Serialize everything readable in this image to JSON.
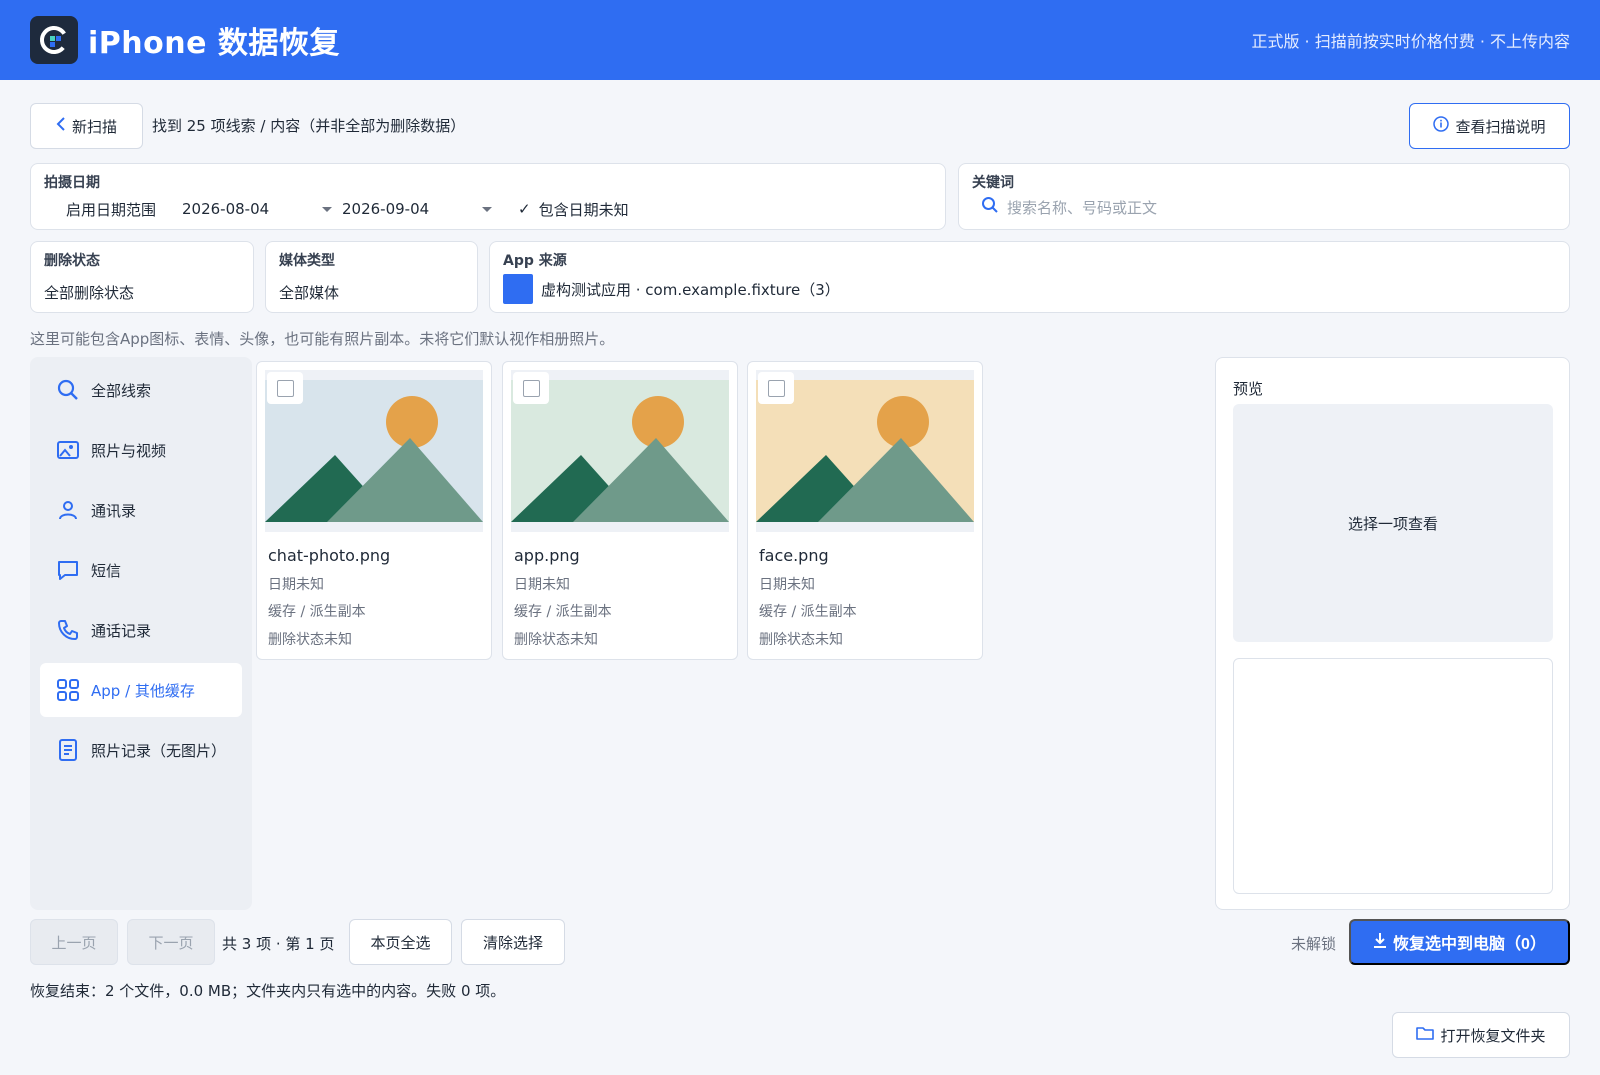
{
  "header": {
    "title": "iPhone 数据恢复",
    "tagline": "正式版 · 扫描前按实时价格付费 · 不上传内容"
  },
  "toolbar": {
    "new_scan": "新扫描",
    "found_text": "找到 25 项线索 / 内容（并非全部为删除数据）",
    "help": "查看扫描说明"
  },
  "filters": {
    "date": {
      "label": "拍摄日期",
      "range_label": "启用日期范围",
      "start": "2026-08-04",
      "end": "2026-09-04",
      "include_unknown": "包含日期未知"
    },
    "keyword": {
      "label": "关键词",
      "placeholder": "搜索名称、号码或正文"
    },
    "delete_status": {
      "label": "删除状态",
      "value": "全部删除状态"
    },
    "media_type": {
      "label": "媒体类型",
      "value": "全部媒体"
    },
    "app_source": {
      "label": "App 来源",
      "value": "虚构测试应用 · com.example.fixture（3）",
      "color": "#2f6df2"
    }
  },
  "hint": "这里可能包含App图标、表情、头像，也可能有照片副本。未将它们默认视作相册照片。",
  "sidebar": {
    "items": [
      {
        "label": "全部线索",
        "icon": "search-icon"
      },
      {
        "label": "照片与视频",
        "icon": "image-icon"
      },
      {
        "label": "通讯录",
        "icon": "person-icon"
      },
      {
        "label": "短信",
        "icon": "message-icon"
      },
      {
        "label": "通话记录",
        "icon": "phone-icon"
      },
      {
        "label": "App / 其他缓存",
        "icon": "grid-icon",
        "active": true
      },
      {
        "label": "照片记录（无图片）",
        "icon": "document-icon"
      }
    ]
  },
  "cards": [
    {
      "name": "chat-photo.png",
      "date": "日期未知",
      "source": "缓存 / 派生副本",
      "status": "删除状态未知",
      "bg": "#d8e4ec"
    },
    {
      "name": "app.png",
      "date": "日期未知",
      "source": "缓存 / 派生副本",
      "status": "删除状态未知",
      "bg": "#d9e9df"
    },
    {
      "name": "face.png",
      "date": "日期未知",
      "source": "缓存 / 派生副本",
      "status": "删除状态未知",
      "bg": "#f4dfb8"
    }
  ],
  "preview": {
    "title": "预览",
    "placeholder": "选择一项查看"
  },
  "pagination": {
    "prev": "上一页",
    "next": "下一页",
    "info": "共 3 项 · 第 1 页",
    "select_all": "本页全选",
    "clear": "清除选择"
  },
  "recover": {
    "locked": "未解锁",
    "button": "恢复选中到电脑（0）"
  },
  "result": "恢复结束：2 个文件，0.0 MB；文件夹内只有选中的内容。失败 0 项。",
  "open_folder": "打开恢复文件夹",
  "colors": {
    "accent": "#2f6df2",
    "header_bg": "#2f6df2",
    "sun": "#e4a24a",
    "mountain_dark": "#216a52",
    "mountain_light": "#6f9a8a"
  }
}
